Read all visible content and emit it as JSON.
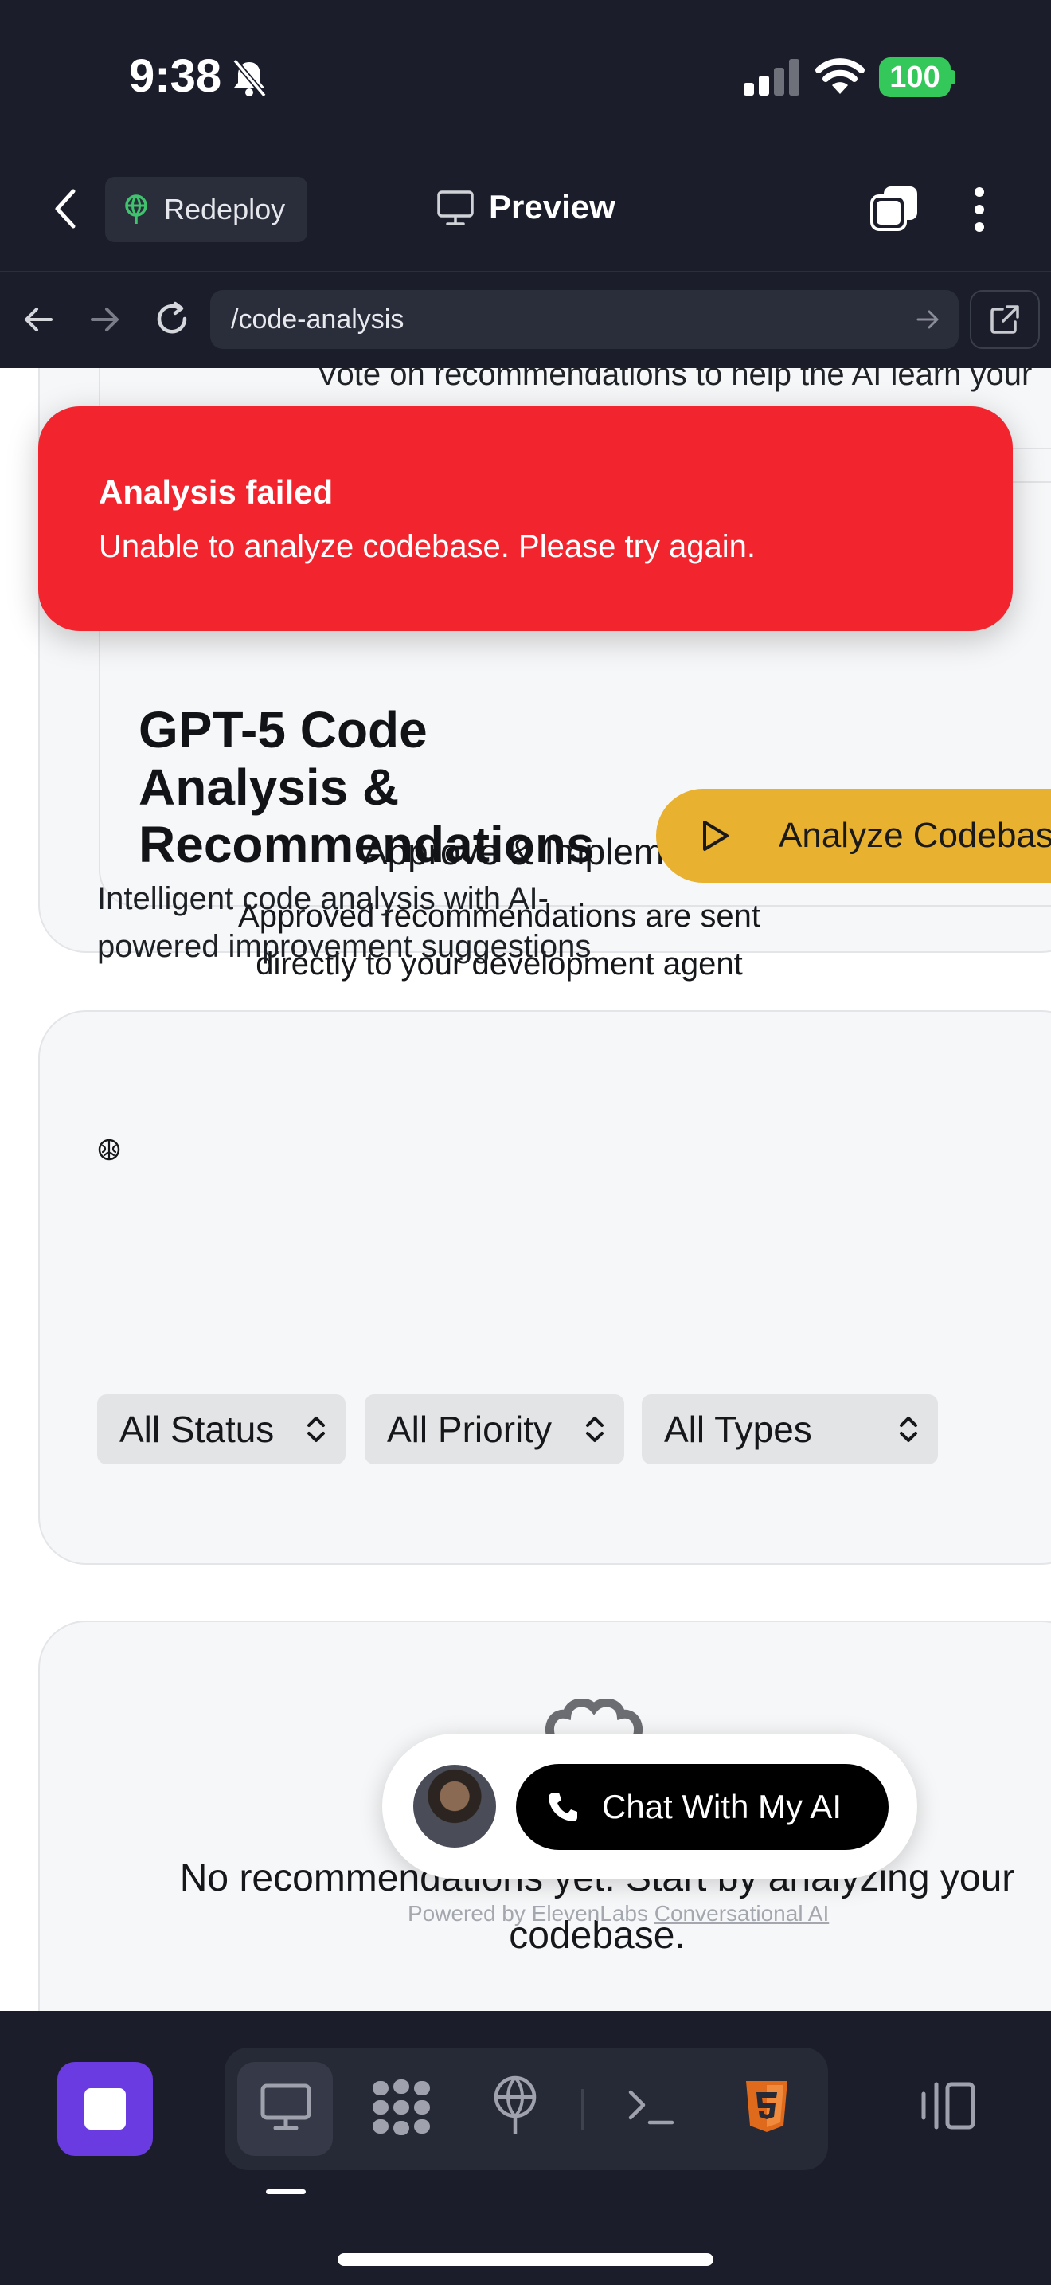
{
  "status_bar": {
    "time": "9:38",
    "battery": "100"
  },
  "nav": {
    "redeploy_label": "Redeploy",
    "preview_label": "Preview"
  },
  "url_bar": {
    "url": "/code-analysis"
  },
  "steps": {
    "vote_text": "Vote on recommendations to help the AI learn your",
    "approve_title": "Approve & Implement",
    "approve_desc": "Approved recommendations are sent directly to your development agent"
  },
  "analysis": {
    "title": "GPT-5 Code Analysis & Recommendations",
    "subtitle": "Intelligent code analysis with AI-powered improvement suggestions",
    "analyze_button": "Analyze Codebase",
    "filters": {
      "status": "All Status",
      "priority": "All Priority",
      "types": "All Types"
    }
  },
  "empty_state": {
    "message": "No recommendations yet. Start by analyzing your codebase."
  },
  "chat_widget": {
    "button_label": "Chat With My AI",
    "powered_prefix": "Powered by ElevenLabs",
    "powered_link": "Conversational AI"
  },
  "toast": {
    "title": "Analysis failed",
    "message": "Unable to analyze codebase. Please try again."
  },
  "colors": {
    "toast": "#f2252f",
    "accent": "#e8b12f",
    "stop": "#6a3be0",
    "battery": "#34c759"
  }
}
